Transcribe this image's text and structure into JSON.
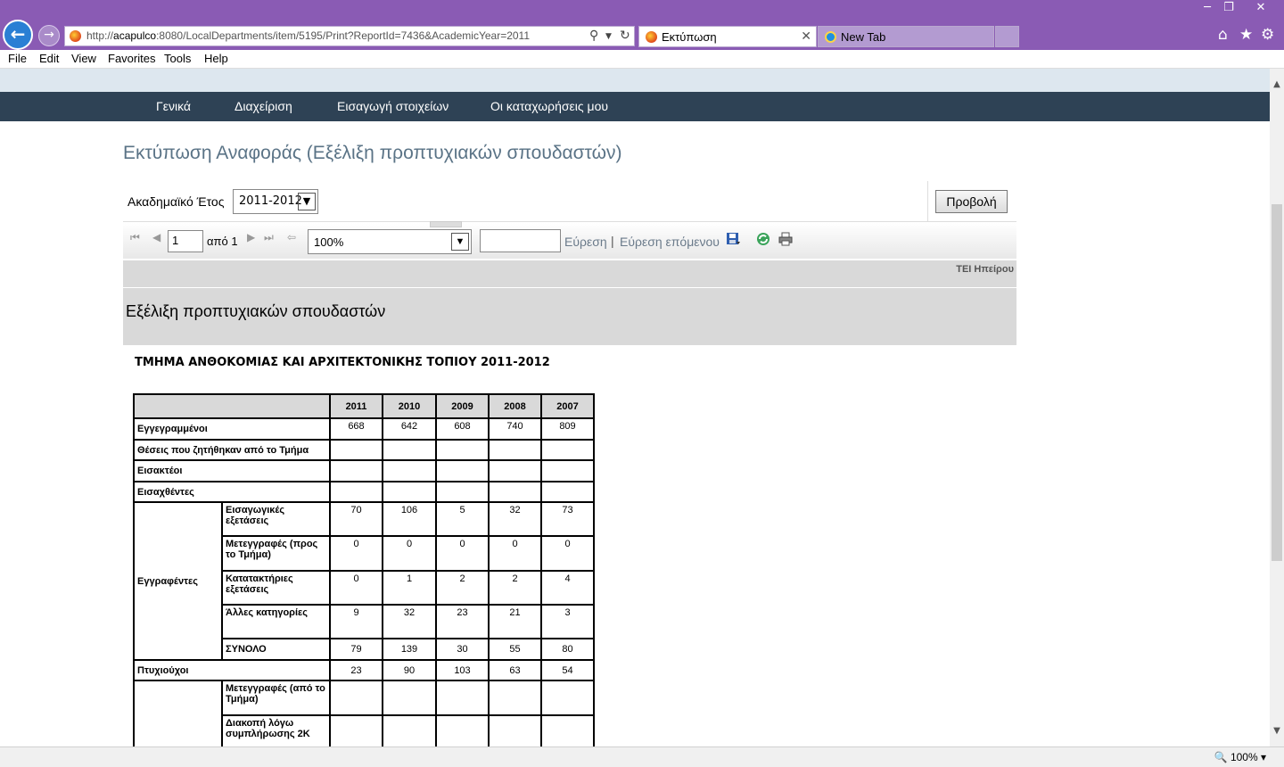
{
  "browser": {
    "url_prefix": "http://",
    "url_host": "acapulco",
    "url_rest": ":8080/LocalDepartments/item/5195/Print?ReportId=7436&AcademicYear=2011",
    "tabs": [
      {
        "label": "Εκτύπωση",
        "active": true
      },
      {
        "label": "New Tab",
        "active": false
      }
    ],
    "menu": [
      "File",
      "Edit",
      "View",
      "Favorites",
      "Tools",
      "Help"
    ],
    "zoom_status": "100%"
  },
  "site_nav": [
    "Γενικά",
    "Διαχείριση",
    "Εισαγωγή στοιχείων",
    "Οι καταχωρήσεις μου"
  ],
  "page_title": "Εκτύπωση Αναφοράς (Εξέλιξη προπτυχιακών σπουδαστών)",
  "params": {
    "year_label": "Ακαδημαϊκό Έτος",
    "year_value": "2011-2012",
    "view_button": "Προβολή"
  },
  "viewer_toolbar": {
    "page": "1",
    "of_label": "από 1",
    "zoom": "100%",
    "find_value": "",
    "find_label": "Εύρεση",
    "separator": "|",
    "find_next_label": "Εύρεση επόμενου"
  },
  "report": {
    "org": "ΤΕΙ Ηπείρου",
    "title": "Εξέλιξη προπτυχιακών σπουδαστών",
    "department_title": "ΤΜΗΜΑ ΑΝΘΟΚΟΜΙΑΣ ΚΑΙ ΑΡΧΙΤΕΚΤΟΝΙΚΗΣ ΤΟΠΙΟΥ 2011-2012",
    "years": [
      "2011",
      "2010",
      "2009",
      "2008",
      "2007"
    ],
    "rows": {
      "enrolled": {
        "label": "Εγγεγραμμένοι",
        "values": [
          "668",
          "642",
          "608",
          "740",
          "809"
        ]
      },
      "positions": {
        "label": "Θέσεις που ζητήθηκαν από το Τμήμα",
        "values": [
          "",
          "",
          "",
          "",
          ""
        ]
      },
      "admissible": {
        "label": "Εισακτέοι",
        "values": [
          "",
          "",
          "",
          "",
          ""
        ]
      },
      "admitted": {
        "label": "Εισαχθέντες",
        "values": [
          "",
          "",
          "",
          "",
          ""
        ]
      },
      "registered_group": "Εγγραφέντες",
      "registered": [
        {
          "label": "Εισαγωγικές εξετάσεις",
          "values": [
            "70",
            "106",
            "5",
            "32",
            "73"
          ]
        },
        {
          "label": "Μετεγγραφές (προς το Τμήμα)",
          "values": [
            "0",
            "0",
            "0",
            "0",
            "0"
          ]
        },
        {
          "label": "Κατατακτήριες εξετάσεις",
          "values": [
            "0",
            "1",
            "2",
            "2",
            "4"
          ]
        },
        {
          "label": "Άλλες κατηγορίες",
          "values": [
            "9",
            "32",
            "23",
            "21",
            "3"
          ]
        },
        {
          "label": "ΣΥΝΟΛΟ",
          "values": [
            "79",
            "139",
            "30",
            "55",
            "80"
          ]
        }
      ],
      "graduates": {
        "label": "Πτυχιούχοι",
        "values": [
          "23",
          "90",
          "103",
          "63",
          "54"
        ]
      },
      "departures": [
        {
          "label": "Μετεγγραφές (από το Τμήμα)",
          "values": [
            "",
            "",
            "",
            "",
            ""
          ]
        },
        {
          "label": "Διακοπή λόγω συμπλήρωσης 2Κ",
          "values": [
            "",
            "",
            "",
            "",
            ""
          ]
        }
      ]
    }
  }
}
